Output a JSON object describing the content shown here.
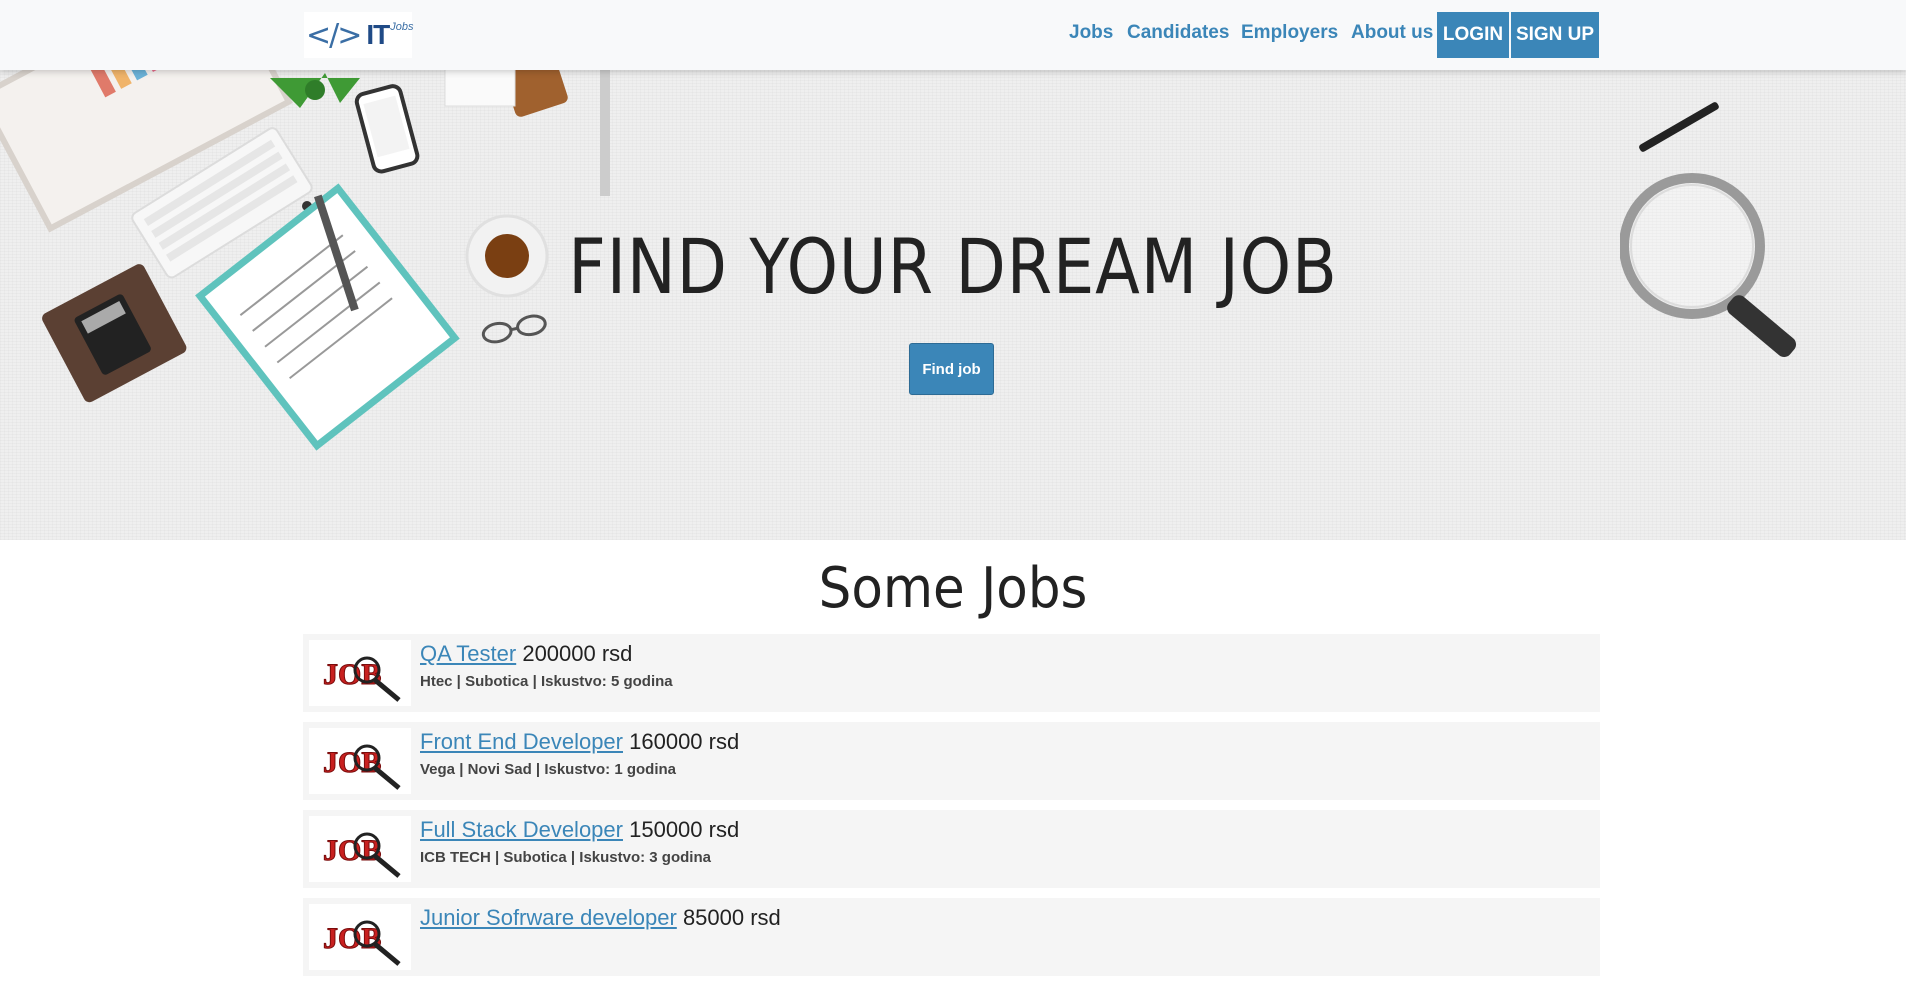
{
  "brand": {
    "code_glyph": "</>",
    "name": "IT",
    "sub": "Jobs"
  },
  "nav": {
    "links": [
      "Jobs",
      "Candidates",
      "Employers",
      "About us"
    ],
    "login": "LOGIN",
    "signup": "SIGN UP"
  },
  "hero": {
    "title": "FIND YOUR DREAM JOB",
    "button": "Find job"
  },
  "jobs_section": {
    "title": "Some Jobs",
    "thumb_text": "JOB",
    "items": [
      {
        "title": "QA Tester",
        "salary": "200000 rsd",
        "company": "Htec",
        "city": "Subotica",
        "experience": "Iskustvo: 5 godina"
      },
      {
        "title": "Front End Developer",
        "salary": "160000 rsd",
        "company": "Vega",
        "city": "Novi Sad",
        "experience": "Iskustvo: 1 godina"
      },
      {
        "title": "Full Stack Developer",
        "salary": "150000 rsd",
        "company": "ICB TECH",
        "city": "Subotica",
        "experience": "Iskustvo: 3 godina"
      },
      {
        "title": "Junior Sofrware developer",
        "salary": "85000 rsd",
        "company": "",
        "city": "",
        "experience": ""
      }
    ]
  },
  "colors": {
    "accent": "#3b86b8",
    "nav_bg": "#f8f9fa",
    "job_bg": "#f5f5f5"
  }
}
